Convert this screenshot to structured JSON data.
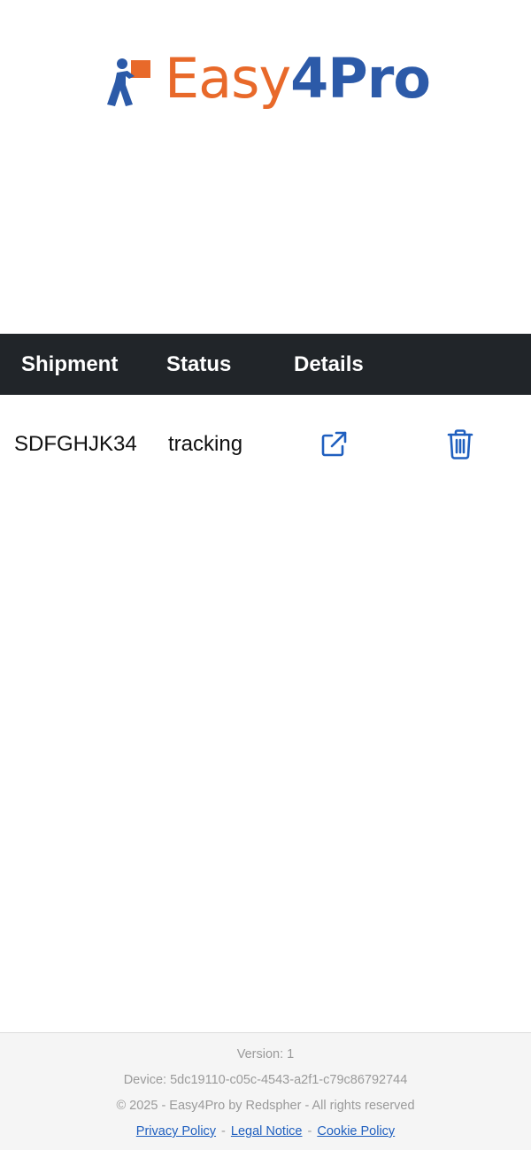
{
  "logo": {
    "text_easy": "Easy",
    "text_pro": "4Pro",
    "colors": {
      "orange": "#e8692a",
      "blue": "#2c5aa8"
    }
  },
  "table": {
    "headers": [
      "Shipment",
      "Status",
      "Details"
    ],
    "rows": [
      {
        "shipment": "SDFGHJK34",
        "status": "tracking",
        "details_icon": "external-link-icon",
        "action_icon": "trash-icon"
      }
    ],
    "header_bg": "#212529",
    "icon_color": "#1f5fbf"
  },
  "footer": {
    "version": "Version: 1",
    "device": "Device: 5dc19110-c05c-4543-a2f1-c79c86792744",
    "copyright": "© 2025 - Easy4Pro by Redspher - All rights reserved",
    "links": [
      "Privacy Policy",
      "Legal Notice",
      "Cookie Policy"
    ],
    "separator": "-"
  }
}
